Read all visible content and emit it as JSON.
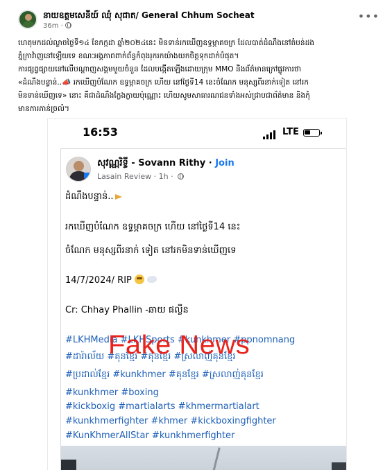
{
  "post": {
    "page_name_khmer": "នាយឧត្តមសេនីយ៍ ឈុំ សុជាត",
    "page_name_separator": "/",
    "page_name_english": "General Chhum Socheat",
    "time": "36m",
    "paragraphs": [
      "ហេតុមកដល់ល្ងាចថ្ងៃទី១៤ ខែកក្កដា ឆ្នាំ២០២៤នេះ មិនទាន់រកឃើញឧទ្ធម្ភាគចក្រ ដែលបាត់ដំណឹងនៅតំបន់ដង",
      "ភ្នំក្រាវ៉ាញនៅឡើយទេ ខណៈអង្គភាពពាក់ព័ន្ធកំពុងរុករកយ៉ាងយកចិត្តទុកដាក់បំផុត។",
      "ការផ្សព្វផ្សាយនៅលើបណ្ដាញសង្គមមួយចំនួន ដែលបង្កើតឡើងដោយក្រុម MMO និងព័ត៌មានក្រៅផ្លូវការថា",
      "«ដំណឹងបន្ទាន់..📣 រកឃើញបំណែក ឧទ្ធម្ភាគចក្រ ហើយ នៅថ្ងៃទី14 នេះចំណែក មនុស្សពីរនាក់ទៀត នៅរក",
      "មិនទាន់ឃើញទេ» នោះ គឺជាដំណឹងក្លែងក្លាយប៉ុណ្ណោះ ហើយសូមសាធារណជនទាំងអស់ជ្រាបជាព័ត៌មាន និងកុំ",
      "មានការភាន់ច្រលំ។"
    ]
  },
  "screenshot": {
    "clock": "16:53",
    "network": "LTE",
    "inner_post": {
      "author_khmer": "សុវណ្ណរិទ្ធី",
      "author_english": "Sovann Rithy",
      "join_label": "Join",
      "group_name": "Lasain Review",
      "time": "1h",
      "line_1": "ដំណឹងបន្ទាន់..",
      "line_2": "រកឃើញបំណែក ឧទ្ធម្ភាគចក្រ ហើយ នៅថ្ងៃទី14 នេះ",
      "line_3": "ចំណែក មនុស្សពីរនាក់ ទៀត នៅរកមិនទាន់ឃើញទេ",
      "date_line": "14/7/2024/ RIP",
      "credit_line": "Cr: Chhay Phallin -ឆាយ ផល្លីន",
      "hashtags": [
        "#LKHMedia #LKHSports #kunkhmer #ppnomnang",
        "#ដារ៉ាល័យ #គុនខ្មែរ #គុនខ្មែរ #ស្រលាញ់គុនខ្មែរ",
        "#ប្រដាល់ខ្មែរ #kunkhmer #គុនខ្មែរ #ស្រលាញ់គុនខ្មែរ",
        "#kunkhmer #boxing",
        "#kickboxig #martialarts #khmermartialart",
        "#kunkhmerfighter #khmer #kickboxingfighter",
        "#KunKhmerAllStar #kunkhmerfighter"
      ]
    },
    "overlay_label": "Fake News"
  },
  "icons": {
    "more": "more-options-icon",
    "privacy": "globe-icon",
    "signal": "signal-bars-icon",
    "battery": "battery-icon"
  },
  "colors": {
    "link_blue": "#1877f2",
    "hashtag_blue": "#1d5fb8",
    "fake_news_red": "#e8231d",
    "meta_gray": "#65676b"
  }
}
